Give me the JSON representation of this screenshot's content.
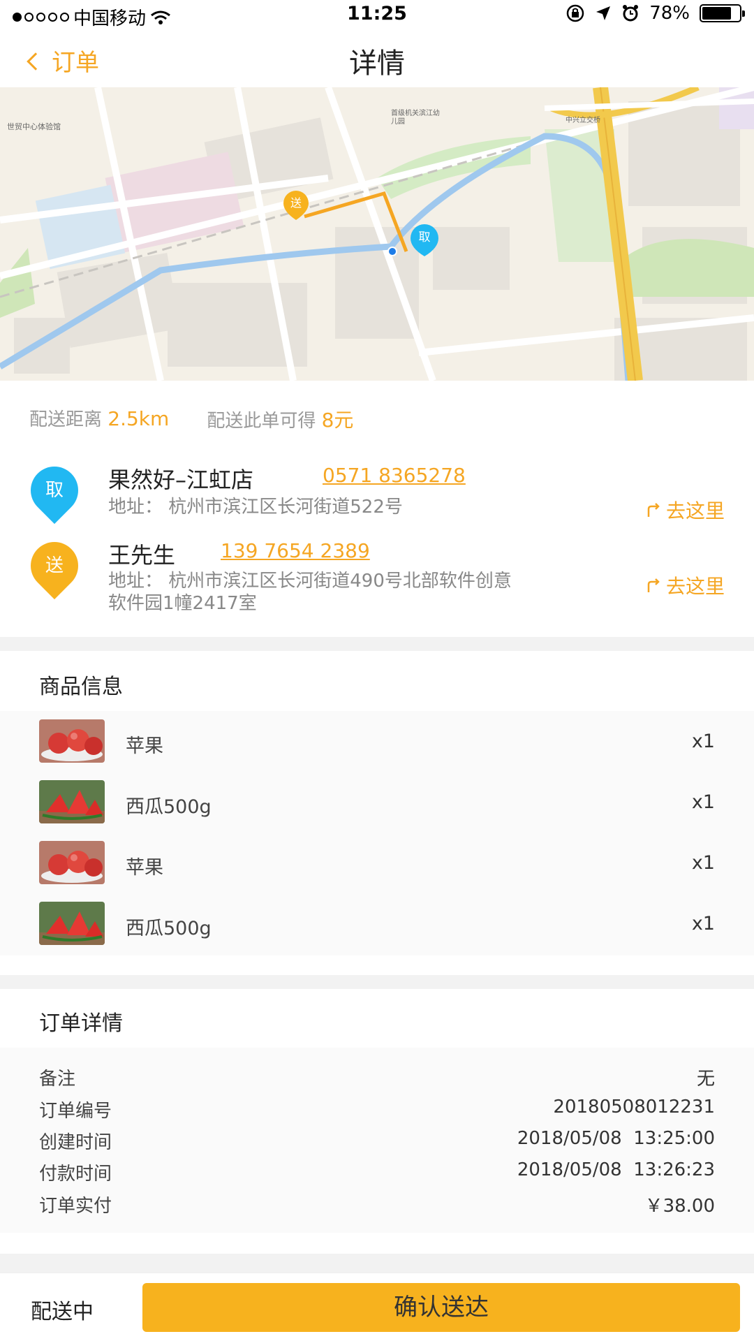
{
  "status_bar": {
    "carrier": "中国移动",
    "time": "11:25",
    "battery": "78%",
    "battery_level": 0.78
  },
  "nav": {
    "back_label": "订单",
    "title": "详情"
  },
  "map": {
    "pickup_marker": "取",
    "dropoff_marker": "送",
    "poi_labels": [
      "世贸中心体验馆",
      "首级机关滨江幼儿园",
      "中兴立交桥"
    ]
  },
  "summary": {
    "distance_label": "配送距离",
    "distance_value": "2.5km",
    "earn_label": "配送此单可得",
    "earn_value": "8元"
  },
  "pickup": {
    "marker": "取",
    "name": "果然好–江虹店",
    "phone": "0571 8365278",
    "address": "地址： 杭州市滨江区长河街道522号",
    "go_label": "去这里"
  },
  "dropoff": {
    "marker": "送",
    "name": "王先生",
    "phone": "139 7654 2389",
    "address": "地址： 杭州市滨江区长河街道490号北部软件创意软件园1幢2417室",
    "go_label": "去这里"
  },
  "goods": {
    "title": "商品信息",
    "items": [
      {
        "name": "苹果",
        "qty": "x1",
        "image": "apple"
      },
      {
        "name": "西瓜500g",
        "qty": "x1",
        "image": "watermelon"
      },
      {
        "name": "苹果",
        "qty": "x1",
        "image": "apple"
      },
      {
        "name": "西瓜500g",
        "qty": "x1",
        "image": "watermelon"
      }
    ]
  },
  "order_details": {
    "title": "订单详情",
    "rows": [
      {
        "label": "备注",
        "value": "无"
      },
      {
        "label": "订单编号",
        "value": "20180508012231"
      },
      {
        "label": "创建时间",
        "value": "2018/05/08  13:25:00"
      },
      {
        "label": "付款时间",
        "value": "2018/05/08  13:26:23"
      },
      {
        "label": "订单实付",
        "value": "￥38.00"
      }
    ]
  },
  "bottom_bar": {
    "status": "配送中",
    "confirm_label": "确认送达"
  },
  "colors": {
    "accent": "#f5a623",
    "button": "#f7b21e",
    "pickup_pin": "#21b8f2"
  }
}
